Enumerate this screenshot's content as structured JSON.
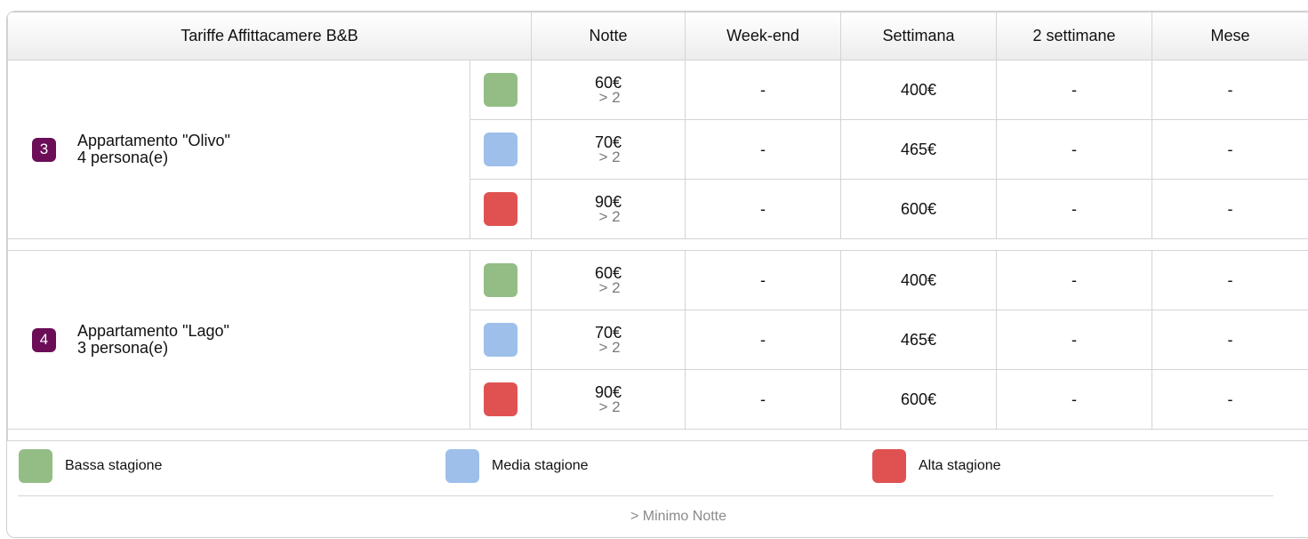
{
  "header": {
    "title": "Tariffe Affittacamere B&B",
    "columns": [
      "Notte",
      "Week-end",
      "Settimana",
      "2 settimane",
      "Mese"
    ]
  },
  "colors": {
    "bassa": "#93bd85",
    "media": "#9dbfea",
    "alta": "#e05252",
    "badge": "#6b0d57"
  },
  "apartments": [
    {
      "number": "3",
      "name": "Appartamento \"Olivo\"",
      "capacity": "4 persona(e)",
      "rates": [
        {
          "season": "bassa",
          "night": "60€",
          "min": "> 2",
          "weekend": "-",
          "week": "400€",
          "two_weeks": "-",
          "month": "-"
        },
        {
          "season": "media",
          "night": "70€",
          "min": "> 2",
          "weekend": "-",
          "week": "465€",
          "two_weeks": "-",
          "month": "-"
        },
        {
          "season": "alta",
          "night": "90€",
          "min": "> 2",
          "weekend": "-",
          "week": "600€",
          "two_weeks": "-",
          "month": "-"
        }
      ]
    },
    {
      "number": "4",
      "name": "Appartamento \"Lago\"",
      "capacity": "3 persona(e)",
      "rates": [
        {
          "season": "bassa",
          "night": "60€",
          "min": "> 2",
          "weekend": "-",
          "week": "400€",
          "two_weeks": "-",
          "month": "-"
        },
        {
          "season": "media",
          "night": "70€",
          "min": "> 2",
          "weekend": "-",
          "week": "465€",
          "two_weeks": "-",
          "month": "-"
        },
        {
          "season": "alta",
          "night": "90€",
          "min": "> 2",
          "weekend": "-",
          "week": "600€",
          "two_weeks": "-",
          "month": "-"
        }
      ]
    }
  ],
  "legend": {
    "bassa": "Bassa stagione",
    "media": "Media stagione",
    "alta": "Alta stagione",
    "note": "> Minimo Notte"
  }
}
